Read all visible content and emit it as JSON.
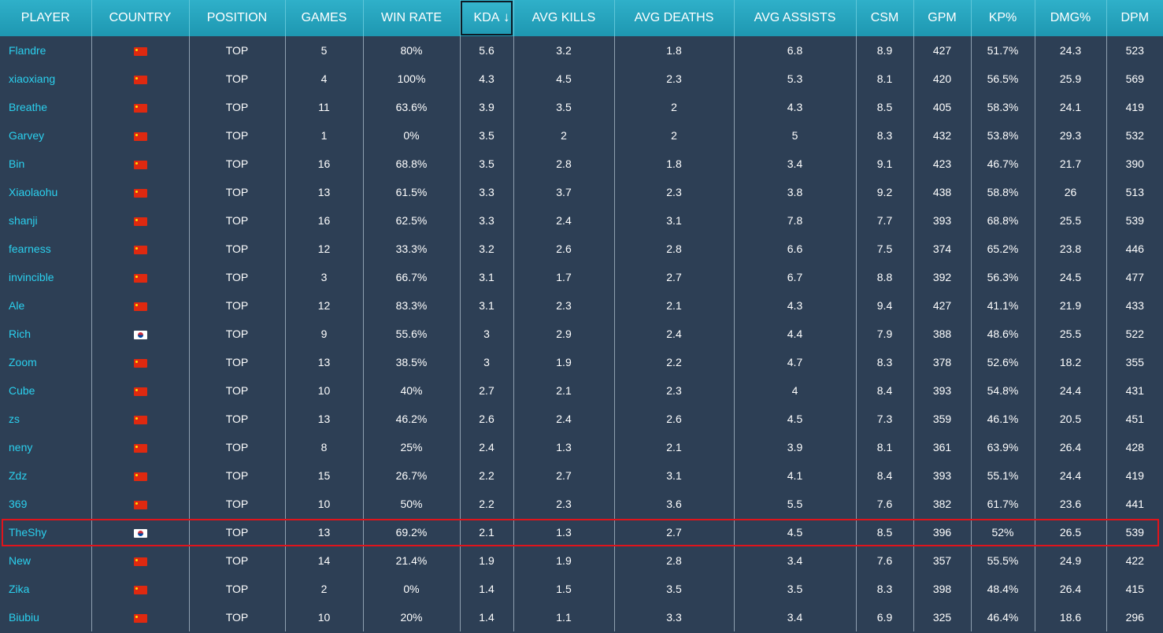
{
  "columns": [
    {
      "key": "player",
      "label": "PLAYER"
    },
    {
      "key": "country",
      "label": "COUNTRY"
    },
    {
      "key": "position",
      "label": "POSITION"
    },
    {
      "key": "games",
      "label": "GAMES"
    },
    {
      "key": "winrate",
      "label": "WIN RATE"
    },
    {
      "key": "kda",
      "label": "KDA",
      "sort_icon": "↓"
    },
    {
      "key": "avg_kills",
      "label": "AVG KILLS"
    },
    {
      "key": "avg_deaths",
      "label": "AVG DEATHS"
    },
    {
      "key": "avg_assists",
      "label": "AVG ASSISTS"
    },
    {
      "key": "csm",
      "label": "CSM"
    },
    {
      "key": "gpm",
      "label": "GPM"
    },
    {
      "key": "kp",
      "label": "KP%"
    },
    {
      "key": "dmg",
      "label": "DMG%"
    },
    {
      "key": "dpm",
      "label": "DPM"
    }
  ],
  "sorted_column": "kda",
  "colors": {
    "header": "#1e97b1",
    "row_bg": "#2d3f55",
    "player_link": "#2bd0ee",
    "highlight": "#e0141b"
  },
  "highlighted_player": "TheShy",
  "rows": [
    [
      "Flandre",
      "cn",
      "TOP",
      "5",
      "80%",
      "5.6",
      "3.2",
      "1.8",
      "6.8",
      "8.9",
      "427",
      "51.7%",
      "24.3",
      "523"
    ],
    [
      "xiaoxiang",
      "cn",
      "TOP",
      "4",
      "100%",
      "4.3",
      "4.5",
      "2.3",
      "5.3",
      "8.1",
      "420",
      "56.5%",
      "25.9",
      "569"
    ],
    [
      "Breathe",
      "cn",
      "TOP",
      "11",
      "63.6%",
      "3.9",
      "3.5",
      "2",
      "4.3",
      "8.5",
      "405",
      "58.3%",
      "24.1",
      "419"
    ],
    [
      "Garvey",
      "cn",
      "TOP",
      "1",
      "0%",
      "3.5",
      "2",
      "2",
      "5",
      "8.3",
      "432",
      "53.8%",
      "29.3",
      "532"
    ],
    [
      "Bin",
      "cn",
      "TOP",
      "16",
      "68.8%",
      "3.5",
      "2.8",
      "1.8",
      "3.4",
      "9.1",
      "423",
      "46.7%",
      "21.7",
      "390"
    ],
    [
      "Xiaolaohu",
      "cn",
      "TOP",
      "13",
      "61.5%",
      "3.3",
      "3.7",
      "2.3",
      "3.8",
      "9.2",
      "438",
      "58.8%",
      "26",
      "513"
    ],
    [
      "shanji",
      "cn",
      "TOP",
      "16",
      "62.5%",
      "3.3",
      "2.4",
      "3.1",
      "7.8",
      "7.7",
      "393",
      "68.8%",
      "25.5",
      "539"
    ],
    [
      "fearness",
      "cn",
      "TOP",
      "12",
      "33.3%",
      "3.2",
      "2.6",
      "2.8",
      "6.6",
      "7.5",
      "374",
      "65.2%",
      "23.8",
      "446"
    ],
    [
      "invincible",
      "cn",
      "TOP",
      "3",
      "66.7%",
      "3.1",
      "1.7",
      "2.7",
      "6.7",
      "8.8",
      "392",
      "56.3%",
      "24.5",
      "477"
    ],
    [
      "Ale",
      "cn",
      "TOP",
      "12",
      "83.3%",
      "3.1",
      "2.3",
      "2.1",
      "4.3",
      "9.4",
      "427",
      "41.1%",
      "21.9",
      "433"
    ],
    [
      "Rich",
      "kr",
      "TOP",
      "9",
      "55.6%",
      "3",
      "2.9",
      "2.4",
      "4.4",
      "7.9",
      "388",
      "48.6%",
      "25.5",
      "522"
    ],
    [
      "Zoom",
      "cn",
      "TOP",
      "13",
      "38.5%",
      "3",
      "1.9",
      "2.2",
      "4.7",
      "8.3",
      "378",
      "52.6%",
      "18.2",
      "355"
    ],
    [
      "Cube",
      "cn",
      "TOP",
      "10",
      "40%",
      "2.7",
      "2.1",
      "2.3",
      "4",
      "8.4",
      "393",
      "54.8%",
      "24.4",
      "431"
    ],
    [
      "zs",
      "cn",
      "TOP",
      "13",
      "46.2%",
      "2.6",
      "2.4",
      "2.6",
      "4.5",
      "7.3",
      "359",
      "46.1%",
      "20.5",
      "451"
    ],
    [
      "neny",
      "cn",
      "TOP",
      "8",
      "25%",
      "2.4",
      "1.3",
      "2.1",
      "3.9",
      "8.1",
      "361",
      "63.9%",
      "26.4",
      "428"
    ],
    [
      "Zdz",
      "cn",
      "TOP",
      "15",
      "26.7%",
      "2.2",
      "2.7",
      "3.1",
      "4.1",
      "8.4",
      "393",
      "55.1%",
      "24.4",
      "419"
    ],
    [
      "369",
      "cn",
      "TOP",
      "10",
      "50%",
      "2.2",
      "2.3",
      "3.6",
      "5.5",
      "7.6",
      "382",
      "61.7%",
      "23.6",
      "441"
    ],
    [
      "TheShy",
      "kr",
      "TOP",
      "13",
      "69.2%",
      "2.1",
      "1.3",
      "2.7",
      "4.5",
      "8.5",
      "396",
      "52%",
      "26.5",
      "539"
    ],
    [
      "New",
      "cn",
      "TOP",
      "14",
      "21.4%",
      "1.9",
      "1.9",
      "2.8",
      "3.4",
      "7.6",
      "357",
      "55.5%",
      "24.9",
      "422"
    ],
    [
      "Zika",
      "cn",
      "TOP",
      "2",
      "0%",
      "1.4",
      "1.5",
      "3.5",
      "3.5",
      "8.3",
      "398",
      "48.4%",
      "26.4",
      "415"
    ],
    [
      "Biubiu",
      "cn",
      "TOP",
      "10",
      "20%",
      "1.4",
      "1.1",
      "3.3",
      "3.4",
      "6.9",
      "325",
      "46.4%",
      "18.6",
      "296"
    ]
  ]
}
